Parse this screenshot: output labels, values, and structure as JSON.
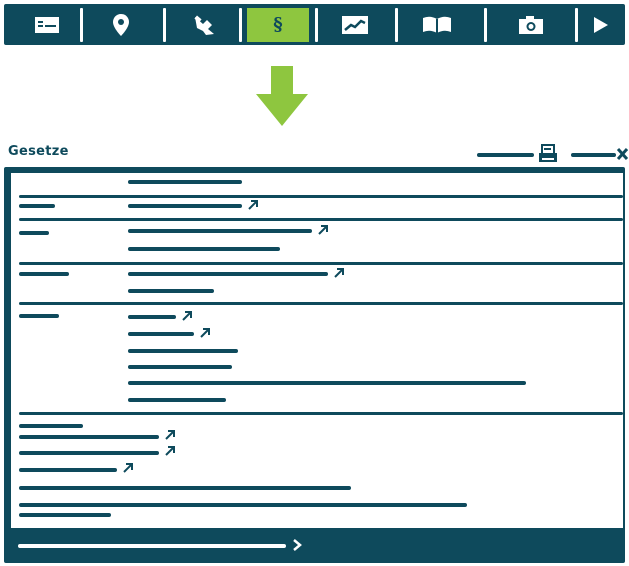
{
  "toolbar": {
    "buttons": [
      {
        "icon": "id-card-icon",
        "active": false
      },
      {
        "icon": "location-pin-icon",
        "active": false
      },
      {
        "icon": "stamp-icon",
        "active": false
      },
      {
        "icon": "paragraph-icon",
        "label": "§",
        "active": true
      },
      {
        "icon": "chart-icon",
        "active": false
      },
      {
        "icon": "open-book-icon",
        "active": false
      },
      {
        "icon": "camera-icon",
        "active": false
      },
      {
        "icon": "play-icon",
        "active": false
      }
    ]
  },
  "panel": {
    "title": "Gesetze",
    "print_icon": "printer-icon",
    "close_icon": "close-icon"
  },
  "colors": {
    "navy": "#0e4a5c",
    "accent": "#8ec63f",
    "background": "#ffffff"
  }
}
